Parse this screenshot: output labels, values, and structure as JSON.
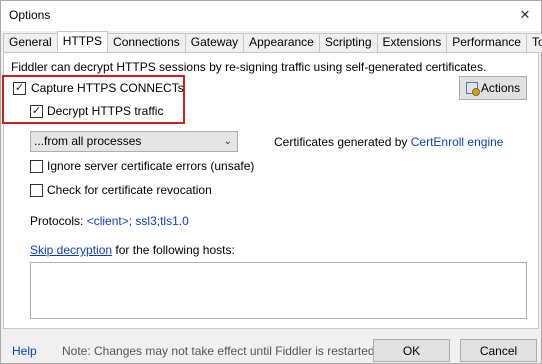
{
  "window": {
    "title": "Options"
  },
  "tabs": [
    {
      "label": "General"
    },
    {
      "label": "HTTPS"
    },
    {
      "label": "Connections"
    },
    {
      "label": "Gateway"
    },
    {
      "label": "Appearance"
    },
    {
      "label": "Scripting"
    },
    {
      "label": "Extensions"
    },
    {
      "label": "Performance"
    },
    {
      "label": "Tools"
    }
  ],
  "active_tab": "HTTPS",
  "https": {
    "intro": "Fiddler can decrypt HTTPS sessions by re-signing traffic using self-generated certificates.",
    "capture_label": "Capture HTTPS CONNECTs",
    "capture_checked": true,
    "decrypt_label": "Decrypt HTTPS traffic",
    "decrypt_checked": true,
    "actions_label": "Actions",
    "process_filter": "...from all processes",
    "certs_prefix": "Certificates generated by",
    "certs_engine": "CertEnroll engine",
    "ignore_errors_label": "Ignore server certificate errors (unsafe)",
    "ignore_errors_checked": false,
    "revocation_label": "Check for certificate revocation",
    "revocation_checked": false,
    "protocols_label": "Protocols:",
    "protocols_value": "<client>; ssl3;tls1.0",
    "skip_link": "Skip decryption",
    "skip_suffix": "for the following hosts:",
    "hosts_value": ""
  },
  "footer": {
    "help": "Help",
    "note": "Note: Changes may not take effect until Fiddler is restarted.",
    "ok": "OK",
    "cancel": "Cancel"
  },
  "colors": {
    "highlight_box": "#cc1f1f",
    "link": "#0b3fc3"
  },
  "icons": {
    "close": "close-icon",
    "actions": "certificate-icon",
    "dropdown": "chevron-down-icon",
    "check": "checkmark-icon"
  }
}
